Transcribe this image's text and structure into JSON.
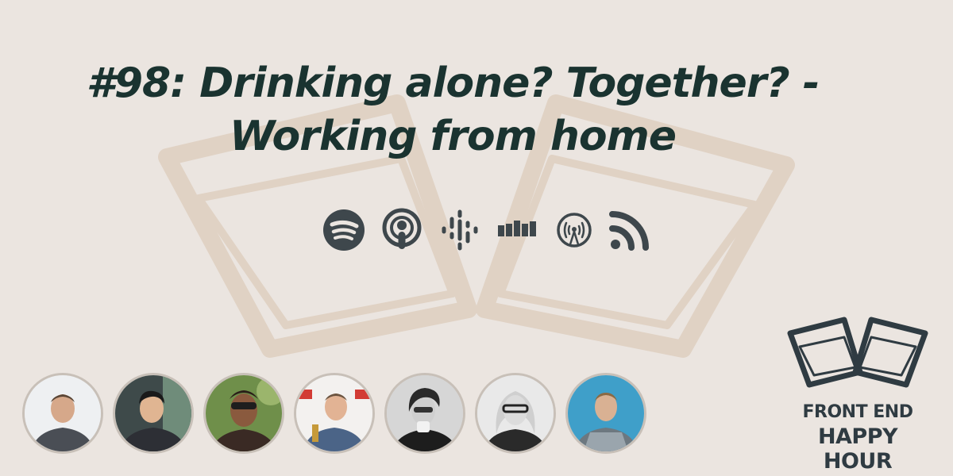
{
  "episode": {
    "title_line1": "#98: Drinking alone? Together? -",
    "title_line2": "Working from home"
  },
  "platforms": [
    {
      "name": "spotify-icon"
    },
    {
      "name": "apple-podcasts-icon"
    },
    {
      "name": "google-podcasts-icon"
    },
    {
      "name": "castbox-icon"
    },
    {
      "name": "overcast-icon"
    },
    {
      "name": "rss-icon"
    }
  ],
  "hosts": [
    {
      "name": "host-avatar-1"
    },
    {
      "name": "host-avatar-2"
    },
    {
      "name": "host-avatar-3"
    },
    {
      "name": "host-avatar-4"
    },
    {
      "name": "host-avatar-5"
    },
    {
      "name": "host-avatar-6"
    },
    {
      "name": "host-avatar-7"
    }
  ],
  "brand": {
    "line1": "FRONT END",
    "line2": "HAPPY HOUR"
  },
  "colors": {
    "background": "#ebe5e0",
    "title": "#1a3330",
    "icons": "#3e474c",
    "watermark": "#e0d2c4",
    "brand": "#2f3b42"
  }
}
